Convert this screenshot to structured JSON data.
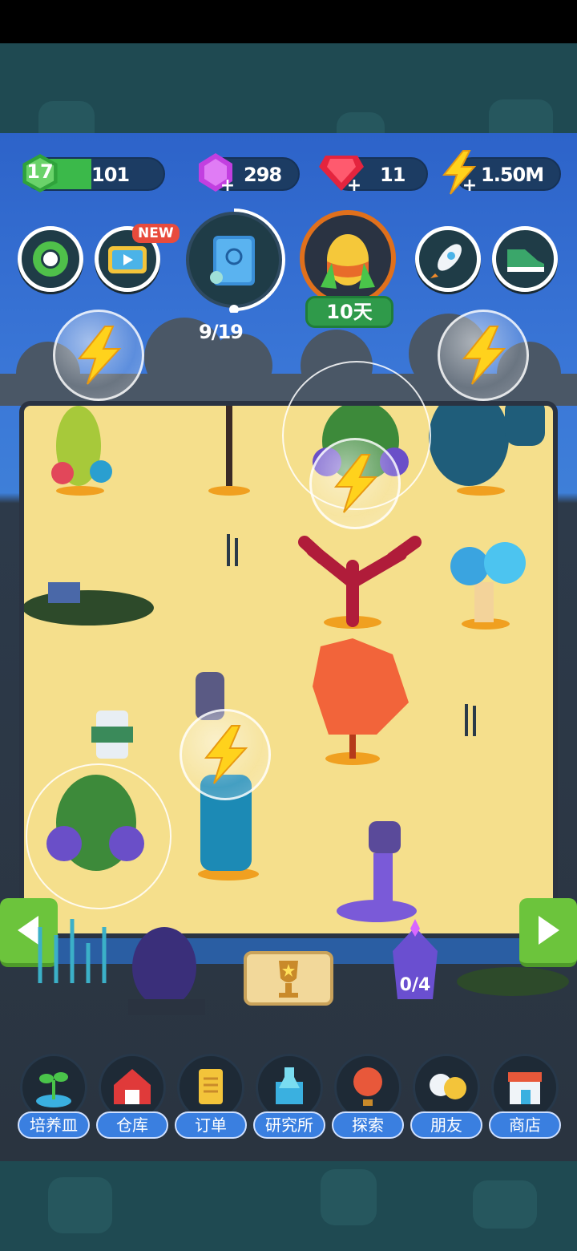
{
  "hud": {
    "level": "17",
    "level_xp": "101",
    "gems_purple": "298",
    "gems_red": "11",
    "energy": "1.50M"
  },
  "top_buttons": {
    "new_badge": "NEW",
    "egg_timer": "10天",
    "sprout_count": "9/19"
  },
  "arena": {
    "crystal_counter": "0/4"
  },
  "nav": {
    "items": [
      {
        "label": "培养皿"
      },
      {
        "label": "仓库"
      },
      {
        "label": "订单"
      },
      {
        "label": "研究所"
      },
      {
        "label": "探索"
      },
      {
        "label": "朋友"
      },
      {
        "label": "商店"
      }
    ]
  },
  "colors": {
    "sky": "#3b78d8",
    "arena": "#f5df8c",
    "nav_label": "#3a7fe0",
    "green_button": "#6cc43c"
  },
  "icons": [
    "settings-gear-icon",
    "video-ad-icon",
    "book-icon",
    "egg-icon",
    "rocket-icon",
    "sneaker-icon",
    "lightning-icon",
    "seedling-icon",
    "barn-icon",
    "scroll-icon",
    "lab-flask-icon",
    "balloon-icon",
    "friends-icon",
    "shop-icon",
    "trophy-icon"
  ]
}
